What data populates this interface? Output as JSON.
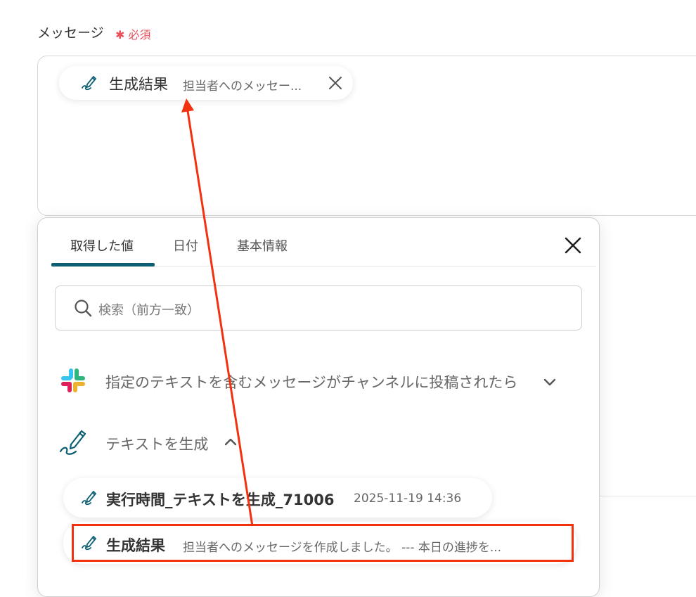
{
  "colors": {
    "accent": "#0d5e74",
    "required": "#e8505b",
    "annotation": "#f2320f",
    "slack_green": "#2eb67d",
    "slack_yellow": "#ecb22e",
    "slack_red": "#e01e5a",
    "slack_blue": "#36c5f0"
  },
  "message": {
    "label": "メッセージ",
    "required": "✱ 必須",
    "chip": {
      "icon": "pencil-scribble-icon",
      "title": "生成結果",
      "preview": "担当者へのメッセー...",
      "close_icon": "close-icon"
    }
  },
  "popover": {
    "tabs": [
      {
        "label": "取得した値",
        "active": true
      },
      {
        "label": "日付",
        "active": false
      },
      {
        "label": "基本情報",
        "active": false
      }
    ],
    "close_icon": "close-icon",
    "search": {
      "placeholder": "検索（前方一致）",
      "icon": "search-icon"
    },
    "groups": [
      {
        "icon": "slack-logo",
        "label": "指定のテキストを含むメッセージがチャンネルに投稿されたら",
        "expanded": false,
        "chevron": "chevron-down-icon"
      },
      {
        "icon": "pencil-scribble-icon",
        "label": "テキストを生成",
        "expanded": true,
        "chevron": "chevron-up-icon"
      }
    ],
    "items": [
      {
        "icon": "pencil-scribble-icon",
        "title": "実行時間_テキストを生成_71006",
        "meta": "2025-11-19 14:36"
      },
      {
        "icon": "pencil-scribble-icon",
        "title": "生成結果",
        "meta": "担当者へのメッセージを作成しました。 --- 本日の進捗を...",
        "highlighted": true
      }
    ]
  }
}
